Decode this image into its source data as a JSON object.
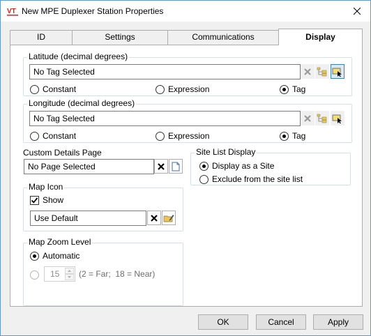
{
  "window": {
    "title": "New MPE Duplexer Station Properties",
    "icon_text": "VT"
  },
  "tabs": [
    {
      "label": "ID"
    },
    {
      "label": "Settings"
    },
    {
      "label": "Communications"
    },
    {
      "label": "Display"
    }
  ],
  "latitude": {
    "label": "Latitude (decimal degrees)",
    "value": "No Tag Selected",
    "options": {
      "constant": "Constant",
      "expression": "Expression",
      "tag": "Tag"
    },
    "selected": "Tag"
  },
  "longitude": {
    "label": "Longitude (decimal degrees)",
    "value": "No Tag Selected",
    "options": {
      "constant": "Constant",
      "expression": "Expression",
      "tag": "Tag"
    },
    "selected": "Tag"
  },
  "custom_details": {
    "label": "Custom Details Page",
    "value": "No Page Selected"
  },
  "site_list": {
    "label": "Site List Display",
    "option_site": "Display as a Site",
    "option_exclude": "Exclude from the site list",
    "selected": "Display as a Site"
  },
  "map_icon": {
    "label": "Map Icon",
    "show_label": "Show",
    "show_checked": true,
    "value": "Use Default"
  },
  "map_zoom": {
    "label": "Map Zoom Level",
    "automatic_label": "Automatic",
    "selected": "Automatic",
    "zoom_value": "15",
    "hint": "(2 = Far;  18 = Near)"
  },
  "buttons": {
    "ok": "OK",
    "cancel": "Cancel",
    "apply": "Apply"
  },
  "colors": {
    "accent": "#3c7fb1",
    "logo_red": "#d62020"
  }
}
